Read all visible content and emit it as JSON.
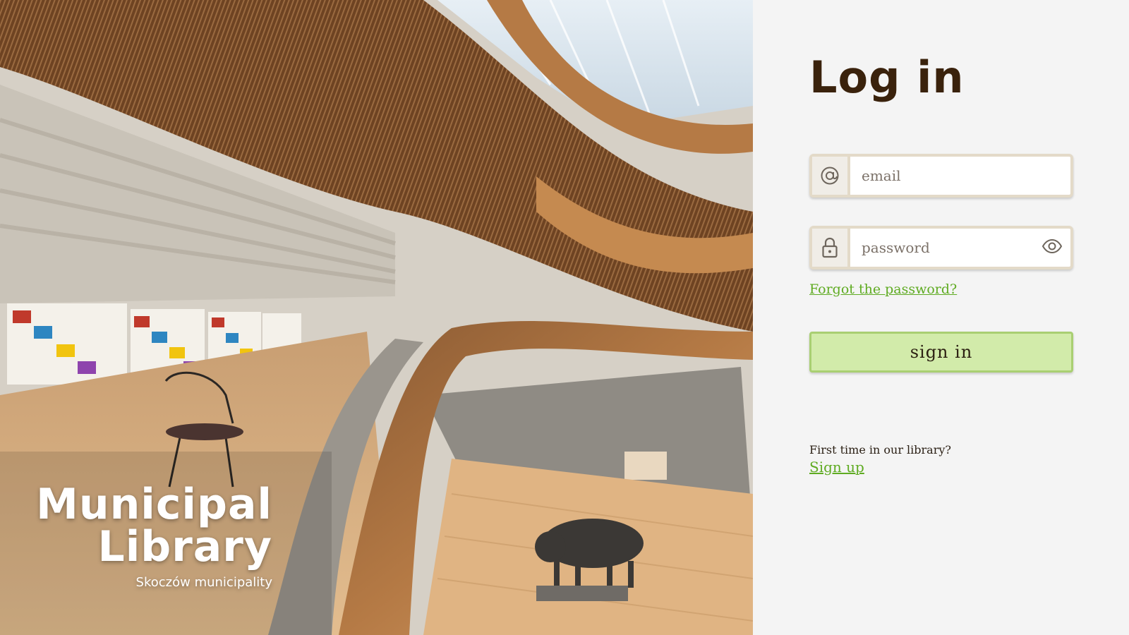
{
  "brand": {
    "name_line1": "Municipal",
    "name_line2": "Library",
    "subtitle": "Skoczów municipality"
  },
  "login": {
    "title": "Log in",
    "email_placeholder": "email",
    "password_placeholder": "password",
    "forgot_label": "Forgot the password?",
    "submit_label": "sign in",
    "first_time_text": "First time in our library?",
    "signup_label": "Sign up"
  },
  "icons": {
    "email": "at-sign-icon",
    "password": "lock-icon",
    "toggle_password": "eye-icon"
  },
  "colors": {
    "title": "#3a220c",
    "link": "#5fab22",
    "button_bg": "#d2ebaa",
    "field_border": "#e3dac8",
    "panel_bg": "#f4f4f4"
  }
}
